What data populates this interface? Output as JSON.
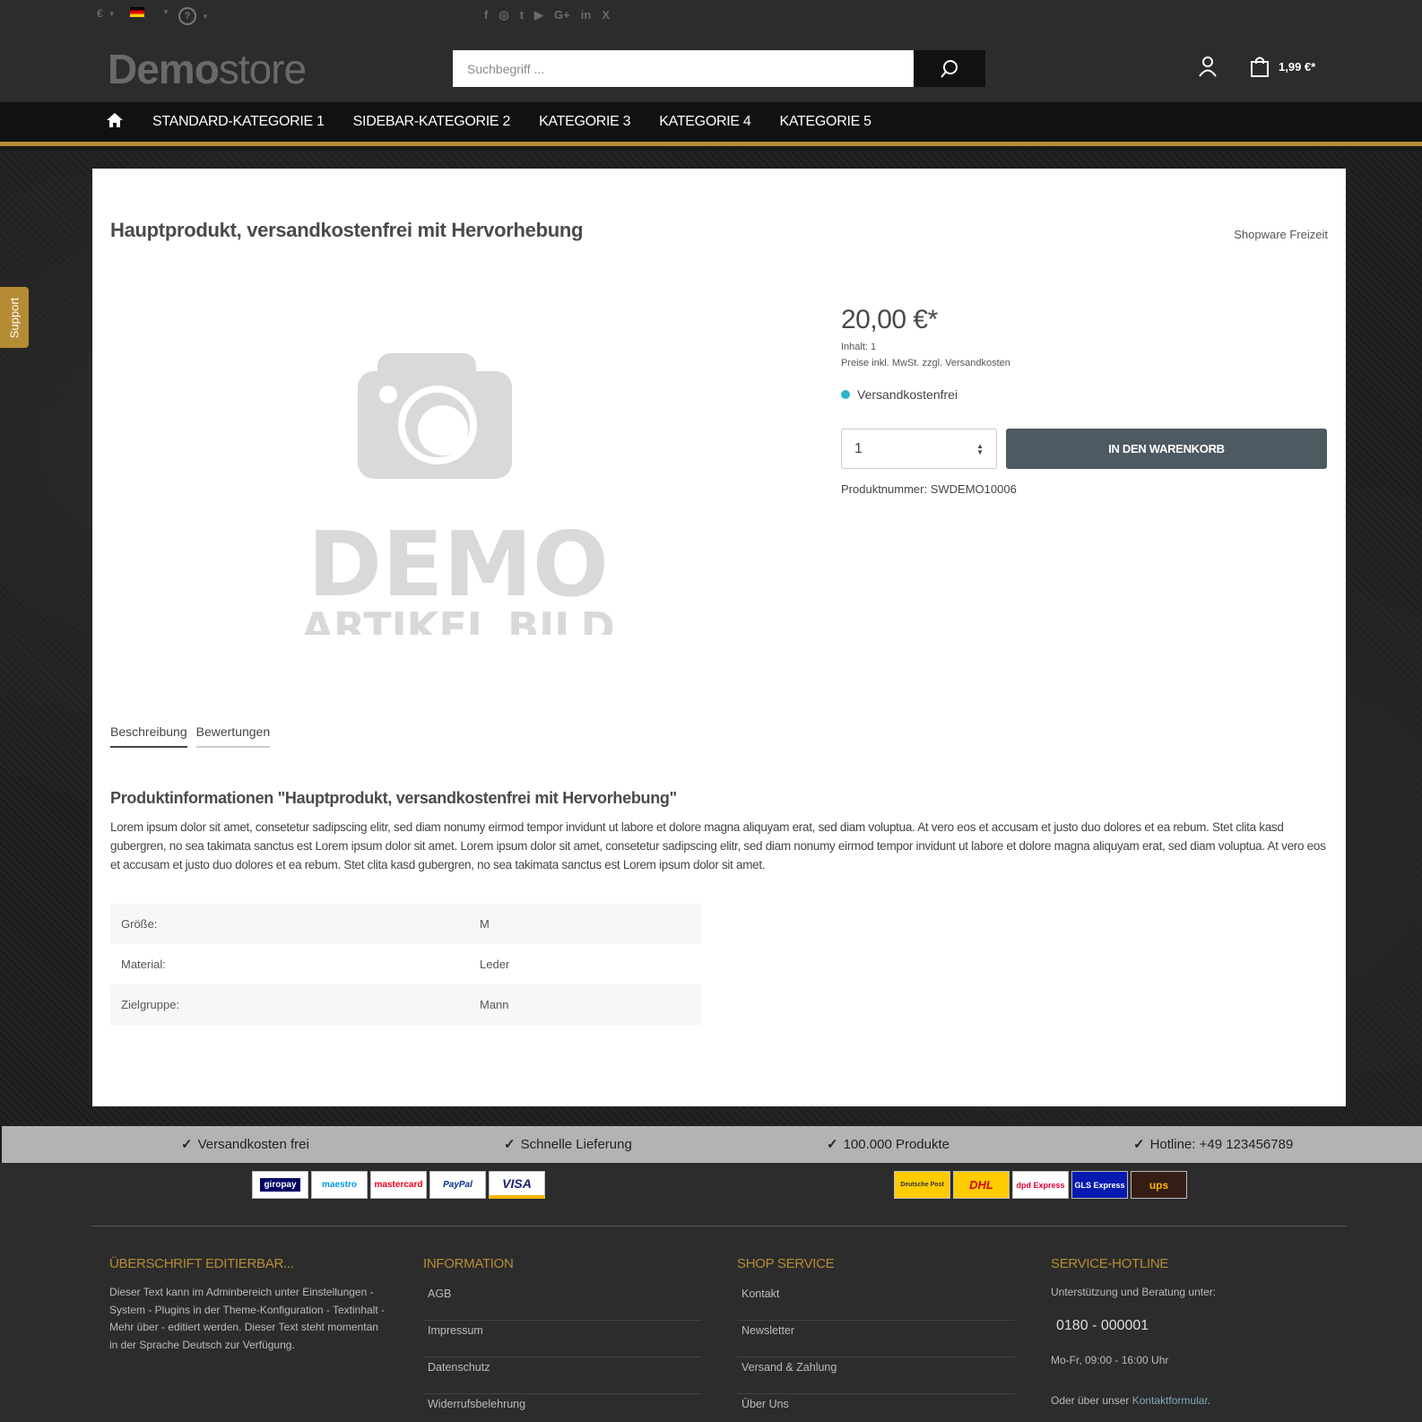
{
  "topbar": {
    "currency": "€",
    "help": "?",
    "socials": [
      "f",
      "◎",
      "t",
      "▶",
      "G+",
      "in",
      "X"
    ]
  },
  "header": {
    "logo_bold": "Demo",
    "logo_light": "store",
    "search_placeholder": "Suchbegriff ...",
    "cart_total": "1,99 €*"
  },
  "nav": {
    "items": [
      "STANDARD-KATEGORIE 1",
      "SIDEBAR-KATEGORIE 2",
      "KATEGORIE 3",
      "KATEGORIE 4",
      "KATEGORIE 5"
    ]
  },
  "support_label": "Support",
  "product": {
    "title": "Hauptprodukt, versandkostenfrei mit Hervorhebung",
    "manufacturer": "Shopware Freizeit",
    "image_line1": "DEMO",
    "image_line2": "ARTIKEL BILD",
    "price": "20,00 €*",
    "content": "Inhalt: 1",
    "tax_note": "Preise inkl. MwSt. zzgl. Versandkosten",
    "delivery": "Versandkostenfrei",
    "quantity": "1",
    "buy_button": "IN DEN WARENKORB",
    "product_number": "Produktnummer: SWDEMO10006"
  },
  "tabs": [
    "Beschreibung",
    "Bewertungen"
  ],
  "description": {
    "title": "Produktinformationen \"Hauptprodukt, versandkostenfrei mit Hervorhebung\"",
    "text": "Lorem ipsum dolor sit amet, consetetur sadipscing elitr, sed diam nonumy eirmod tempor invidunt ut labore et dolore magna aliquyam erat, sed diam voluptua. At vero eos et accusam et justo duo dolores et ea rebum. Stet clita kasd gubergren, no sea takimata sanctus est Lorem ipsum dolor sit amet. Lorem ipsum dolor sit amet, consetetur sadipscing elitr, sed diam nonumy eirmod tempor invidunt ut labore et dolore magna aliquyam erat, sed diam voluptua. At vero eos et accusam et justo duo dolores et ea rebum. Stet clita kasd gubergren, no sea takimata sanctus est Lorem ipsum dolor sit amet.",
    "properties": [
      {
        "key": "Größe:",
        "value": "M"
      },
      {
        "key": "Material:",
        "value": "Leder"
      },
      {
        "key": "Zielgruppe:",
        "value": "Mann"
      }
    ]
  },
  "usp": [
    "Versandkosten frei",
    "Schnelle Lieferung",
    "100.000 Produkte",
    "Hotline: +49 123456789"
  ],
  "payment_logos": [
    "giropay",
    "maestro",
    "mastercard",
    "PayPal",
    "VISA"
  ],
  "shipping_logos": [
    "Deutsche Post",
    "DHL",
    "dpd Express",
    "GLS Express",
    "ups"
  ],
  "footer": {
    "col1": {
      "title": "ÜBERSCHRIFT EDITIERBAR...",
      "text": "Dieser Text kann im Adminbereich unter Einstellungen - System - Plugins in der Theme-Konfiguration - Textinhalt - Mehr über - editiert werden. Dieser Text steht momentan in der Sprache Deutsch zur Verfügung."
    },
    "col2": {
      "title": "INFORMATION",
      "links": [
        "AGB",
        "Impressum",
        "Datenschutz",
        "Widerrufsbelehrung"
      ]
    },
    "col3": {
      "title": "SHOP SERVICE",
      "links": [
        "Kontakt",
        "Newsletter",
        "Versand & Zahlung",
        "Über Uns"
      ]
    },
    "col4": {
      "title": "SERVICE-HOTLINE",
      "support_text": "Unterstützung und Beratung unter:",
      "phone": "0180 - 000001",
      "hours": "Mo-Fr, 09:00 - 16:00 Uhr",
      "contact_prefix": "Oder über unser",
      "contact_link": "Kontaktformular"
    }
  },
  "colors": {
    "accent": "#b58c34",
    "buy_button": "#4d5a61",
    "delivery_dot": "#2fb3c8"
  }
}
